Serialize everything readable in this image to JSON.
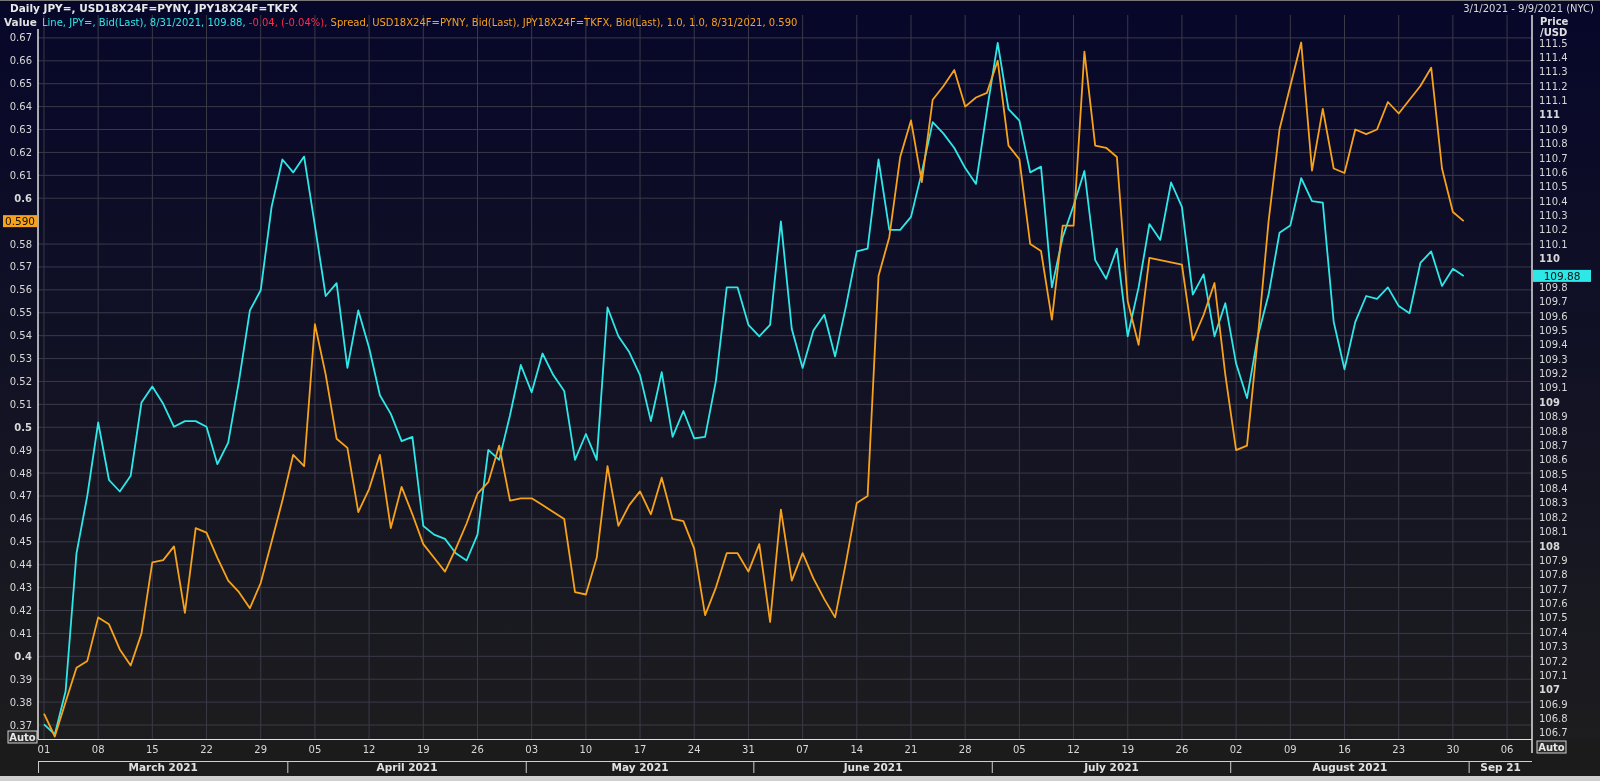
{
  "title_bar": {
    "title": "Daily JPY=, USD18X24F=PYNY, JPY18X24F=TKFX",
    "date_range": "3/1/2021 - 9/9/2021 (NYC)"
  },
  "chart": {
    "legend": [
      {
        "text": "Line, JPY=, Bid(Last), 8/31/2021, 109.88,",
        "color": "#2ee8e8"
      },
      {
        "text": "-0.04, (-0.04%),",
        "color": "#ff2a4a"
      },
      {
        "text": "Spread, USD18X24F=PYNY, Bid(Last), JPY18X24F=TKFX, Bid(Last),  1.0, 1.0, 8/31/2021, 0.590",
        "color": "#f7a21b"
      }
    ],
    "auto_buttons": [
      "Auto",
      "Auto"
    ],
    "value_tags": [
      {
        "label": "109.88",
        "color": "#2ee8e8"
      },
      {
        "label": "0.590",
        "color": "#f7a21b"
      }
    ],
    "chart_data": {
      "type": "line",
      "grid": true,
      "ylabel": "Value",
      "y2label": [
        "Price",
        "/USD"
      ],
      "categories": [
        "01",
        null,
        null,
        null,
        null,
        "08",
        null,
        null,
        null,
        null,
        "15",
        null,
        null,
        null,
        null,
        "22",
        null,
        null,
        null,
        null,
        "29",
        null,
        null,
        null,
        null,
        "05",
        null,
        null,
        null,
        null,
        "12",
        null,
        null,
        null,
        null,
        "19",
        null,
        null,
        null,
        null,
        "26",
        null,
        null,
        null,
        null,
        "03",
        null,
        null,
        null,
        null,
        "10",
        null,
        null,
        null,
        null,
        "17",
        null,
        null,
        null,
        null,
        "24",
        null,
        null,
        null,
        null,
        "31",
        null,
        null,
        null,
        null,
        "07",
        null,
        null,
        null,
        null,
        "14",
        null,
        null,
        null,
        null,
        "21",
        null,
        null,
        null,
        null,
        "28",
        null,
        null,
        null,
        null,
        "05",
        null,
        null,
        null,
        null,
        "12",
        null,
        null,
        null,
        null,
        "19",
        null,
        null,
        null,
        null,
        "26",
        null,
        null,
        null,
        null,
        "02",
        null,
        null,
        null,
        null,
        "09",
        null,
        null,
        null,
        null,
        "16",
        null,
        null,
        null,
        null,
        "23",
        null,
        null,
        null,
        null,
        "30",
        null,
        null,
        null,
        null,
        "06",
        null,
        null
      ],
      "series": [
        {
          "color": "#2ee8e8",
          "axis": "y2",
          "values": [
            106.76,
            106.69,
            106.99,
            107.95,
            108.35,
            108.86,
            108.46,
            108.38,
            108.49,
            109.0,
            109.11,
            108.99,
            108.83,
            108.87,
            108.87,
            108.83,
            108.57,
            108.72,
            109.15,
            109.64,
            109.78,
            110.36,
            110.69,
            110.6,
            110.71,
            110.23,
            109.74,
            109.83,
            109.24,
            109.64,
            109.38,
            109.05,
            108.92,
            108.73,
            108.76,
            108.14,
            108.08,
            108.05,
            107.95,
            107.9,
            108.08,
            108.67,
            108.6,
            108.91,
            109.26,
            109.07,
            109.34,
            109.19,
            109.08,
            108.6,
            108.78,
            108.6,
            109.66,
            109.46,
            109.35,
            109.19,
            108.87,
            109.21,
            108.76,
            108.94,
            108.75,
            108.76,
            109.15,
            109.8,
            109.8,
            109.54,
            109.46,
            109.54,
            110.26,
            109.51,
            109.24,
            109.5,
            109.61,
            109.32,
            109.67,
            110.05,
            110.07,
            110.69,
            110.2,
            110.2,
            110.29,
            110.6,
            110.95,
            110.87,
            110.77,
            110.63,
            110.52,
            111.03,
            111.5,
            111.04,
            110.96,
            110.6,
            110.64,
            109.8,
            110.15,
            110.37,
            110.61,
            109.99,
            109.86,
            110.07,
            109.46,
            109.8,
            110.24,
            110.13,
            110.53,
            110.36,
            109.75,
            109.89,
            109.46,
            109.69,
            109.27,
            109.03,
            109.46,
            109.75,
            110.18,
            110.23,
            110.56,
            110.4,
            110.39,
            109.56,
            109.23,
            109.56,
            109.74,
            109.72,
            109.8,
            109.67,
            109.62,
            109.97,
            110.05,
            109.81,
            109.93,
            109.88,
            null,
            null,
            null,
            null,
            null,
            null
          ]
        },
        {
          "color": "#f7a21b",
          "values": [
            0.375,
            0.365,
            0.38,
            0.395,
            0.398,
            0.417,
            0.414,
            0.403,
            0.396,
            0.41,
            0.441,
            0.442,
            0.448,
            0.419,
            0.456,
            0.454,
            0.443,
            0.433,
            0.428,
            0.421,
            0.432,
            0.45,
            0.468,
            0.488,
            0.483,
            0.545,
            0.523,
            0.495,
            0.491,
            0.463,
            0.473,
            0.488,
            0.456,
            0.474,
            0.462,
            0.449,
            0.443,
            0.437,
            0.447,
            0.458,
            0.471,
            0.476,
            0.492,
            0.468,
            0.469,
            0.469,
            0.466,
            0.463,
            0.46,
            0.428,
            0.427,
            0.443,
            0.483,
            0.457,
            0.466,
            0.472,
            0.462,
            0.478,
            0.46,
            0.459,
            0.447,
            0.418,
            0.43,
            0.445,
            0.445,
            0.437,
            0.449,
            0.415,
            0.464,
            0.433,
            0.445,
            0.434,
            0.425,
            0.417,
            0.441,
            0.467,
            0.47,
            0.566,
            0.583,
            0.618,
            0.634,
            0.607,
            0.643,
            0.649,
            0.656,
            0.64,
            0.644,
            0.646,
            0.66,
            0.623,
            0.617,
            0.58,
            0.577,
            0.547,
            0.588,
            0.588,
            0.664,
            0.623,
            0.622,
            0.618,
            0.555,
            0.536,
            0.574,
            0.573,
            0.572,
            0.571,
            0.538,
            0.549,
            0.563,
            0.523,
            0.49,
            0.492,
            0.539,
            0.59,
            0.63,
            0.649,
            0.668,
            0.612,
            0.639,
            0.613,
            0.611,
            0.63,
            0.628,
            0.63,
            0.642,
            0.637,
            0.643,
            0.649,
            0.657,
            0.613,
            0.594,
            0.59,
            null,
            null,
            null,
            null,
            null,
            null
          ]
        }
      ],
      "ylim": [
        0.3639,
        0.68
      ],
      "y2lim": [
        106.658,
        111.695
      ],
      "yticks": [
        0.37,
        0.38,
        0.39,
        0.4,
        0.41,
        0.42,
        0.43,
        0.44,
        0.45,
        0.46,
        0.47,
        0.48,
        0.49,
        0.5,
        0.51,
        0.52,
        0.53,
        0.54,
        0.55,
        0.56,
        0.57,
        0.58,
        0.6,
        0.61,
        0.62,
        0.63,
        0.64,
        0.65,
        0.66,
        0.67
      ],
      "y2ticks": [
        106.7,
        106.8,
        106.9,
        107,
        107.1,
        107.2,
        107.3,
        107.4,
        107.5,
        107.6,
        107.7,
        107.8,
        107.9,
        108,
        108.1,
        108.2,
        108.3,
        108.4,
        108.5,
        108.6,
        108.7,
        108.8,
        108.9,
        109,
        109.1,
        109.2,
        109.3,
        109.4,
        109.5,
        109.6,
        109.7,
        109.8,
        110,
        110.1,
        110.2,
        110.3,
        110.4,
        110.5,
        110.6,
        110.7,
        110.8,
        110.9,
        111,
        111.1,
        111.2,
        111.3,
        111.4,
        111.5
      ],
      "annotations": [
        "March 2021",
        "April 2021",
        "May 2021",
        "June 2021",
        "July 2021",
        "August 2021",
        "Sep 21"
      ]
    }
  }
}
